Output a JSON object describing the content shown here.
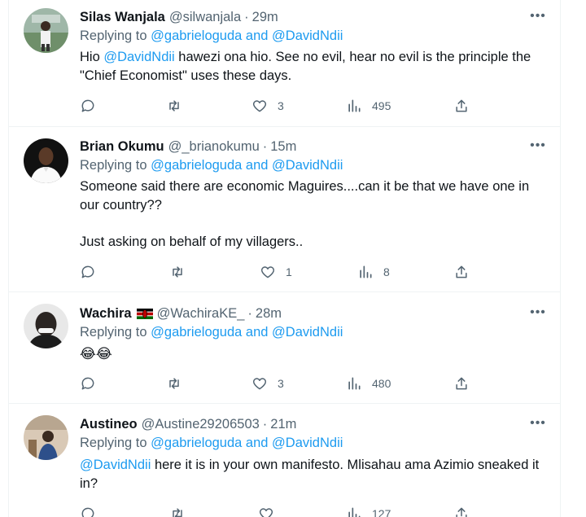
{
  "tweets": [
    {
      "name": "Silas Wanjala",
      "handle": "@silwanjala",
      "time": "29m",
      "replying_prefix": "Replying to",
      "reply_user1": "@gabrieloguda",
      "reply_and": "and",
      "reply_user2": "@DavidNdii",
      "text_prefix": "Hio ",
      "text_mention": "@DavidNdii",
      "text_rest": " hawezi ona hio. See no evil, hear no evil is the principle the \"Chief Economist\" uses these days.",
      "likes": "3",
      "views": "495"
    },
    {
      "name": "Brian Okumu",
      "handle": "@_brianokumu",
      "time": "15m",
      "replying_prefix": "Replying to",
      "reply_user1": "@gabrieloguda",
      "reply_and": "and",
      "reply_user2": "@DavidNdii",
      "text_line1": "Someone said there are economic Maguires....can it be that we have one in our country??",
      "text_line2": "Just asking on behalf of my villagers..",
      "likes": "1",
      "views": "8"
    },
    {
      "name": "Wachira",
      "flag_icon": "kenya-flag",
      "handle": "@WachiraKE_",
      "time": "28m",
      "replying_prefix": "Replying to",
      "reply_user1": "@gabrieloguda",
      "reply_and": "and",
      "reply_user2": "@DavidNdii",
      "text_emoji": "😂😂",
      "likes": "3",
      "views": "480"
    },
    {
      "name": "Austineo",
      "handle": "@Austine29206503",
      "time": "21m",
      "replying_prefix": "Replying to",
      "reply_user1": "@gabrieloguda",
      "reply_and": "and",
      "reply_user2": "@DavidNdii",
      "text_mention": "@DavidNdii",
      "text_rest": " here it is in your own manifesto. Mlisahau ama Azimio sneaked it in?",
      "views": "127"
    }
  ],
  "ui": {
    "separator": "·",
    "more_glyph": "•••",
    "icons": [
      "reply-icon",
      "retweet-icon",
      "like-icon",
      "views-icon",
      "share-icon",
      "more-icon"
    ]
  },
  "colors": {
    "text": "#0f1419",
    "secondary": "#536471",
    "link": "#1d9bf0",
    "border": "#eff3f4"
  }
}
